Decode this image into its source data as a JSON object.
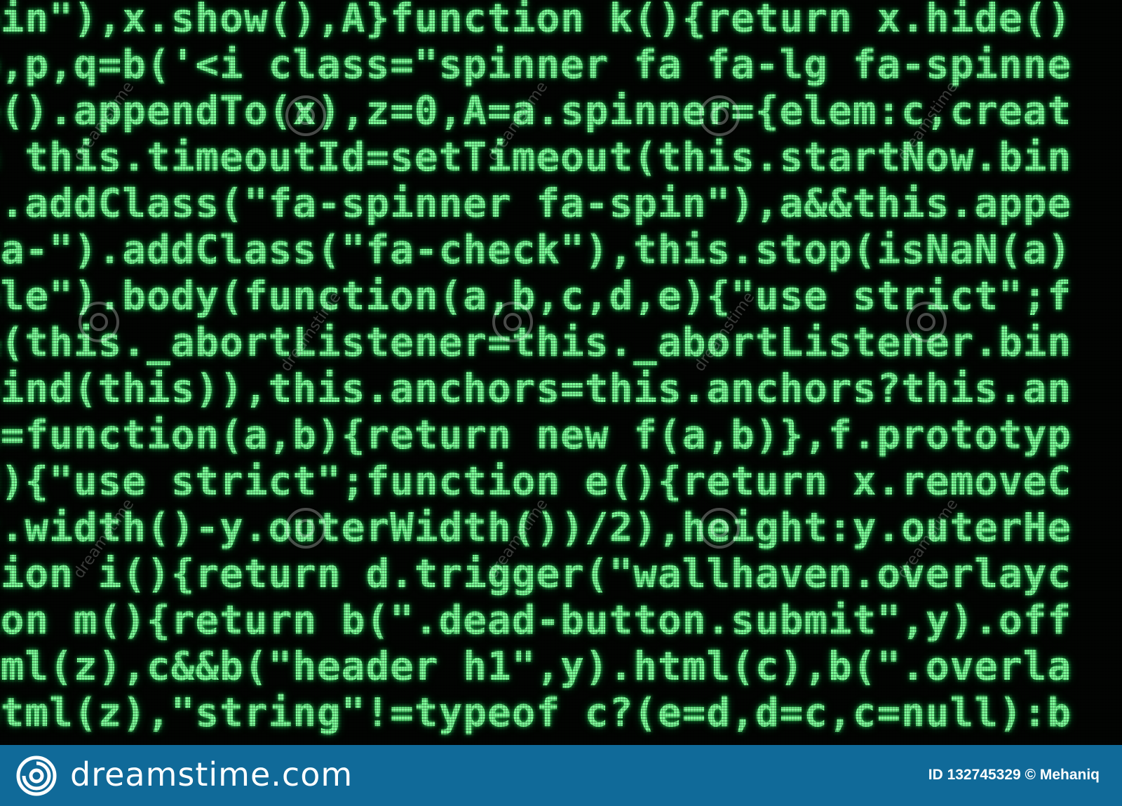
{
  "code": {
    "lines": [
      "pin\"),x.show(),A}function k(){return x.hide()",
      "p,p,q=b('<i class=\"spinner fa fa-lg fa-spinne",
      "e().appendTo(x),z=0,A=a.spinner={elem:c,creat",
      "n this.timeoutId=setTimeout(this.startNow.bin",
      ").addClass(\"fa-spinner fa-spin\"),a&&this.appe",
      "fa-\").addClass(\"fa-check\"),this.stop(isNaN(a)",
      "ble\").body(function(a,b,c,d,e){\"use strict\";f",
      "&(this._abortListener=this._abortListener.bin",
      "bind(this)),this.anchors=this.anchors?this.an",
      "e=function(a,b){return new f(a,b)},f.prototyp",
      "d){\"use strict\";function e(){return x.removeC",
      "c.width()-y.outerWidth())/2),height:y.outerHe",
      "tion i(){return d.trigger(\"wallhaven.overlayc",
      "ion m(){return b(\".dead-button.submit\",y).off",
      "tml(z),c&&b(\"header h1\",y).html(c),b(\".overla",
      "html(z),\"string\"!=typeof c?(e=d,d=c,c=null):b"
    ],
    "color": "#7dff9a"
  },
  "watermark": {
    "text": "dreamstime",
    "icon": "dreamstime-swirl-icon"
  },
  "footer": {
    "logo_text": "dreamstime.com",
    "image_credit": "ID 132745329 © Mehaniq",
    "background": "#106a99"
  }
}
